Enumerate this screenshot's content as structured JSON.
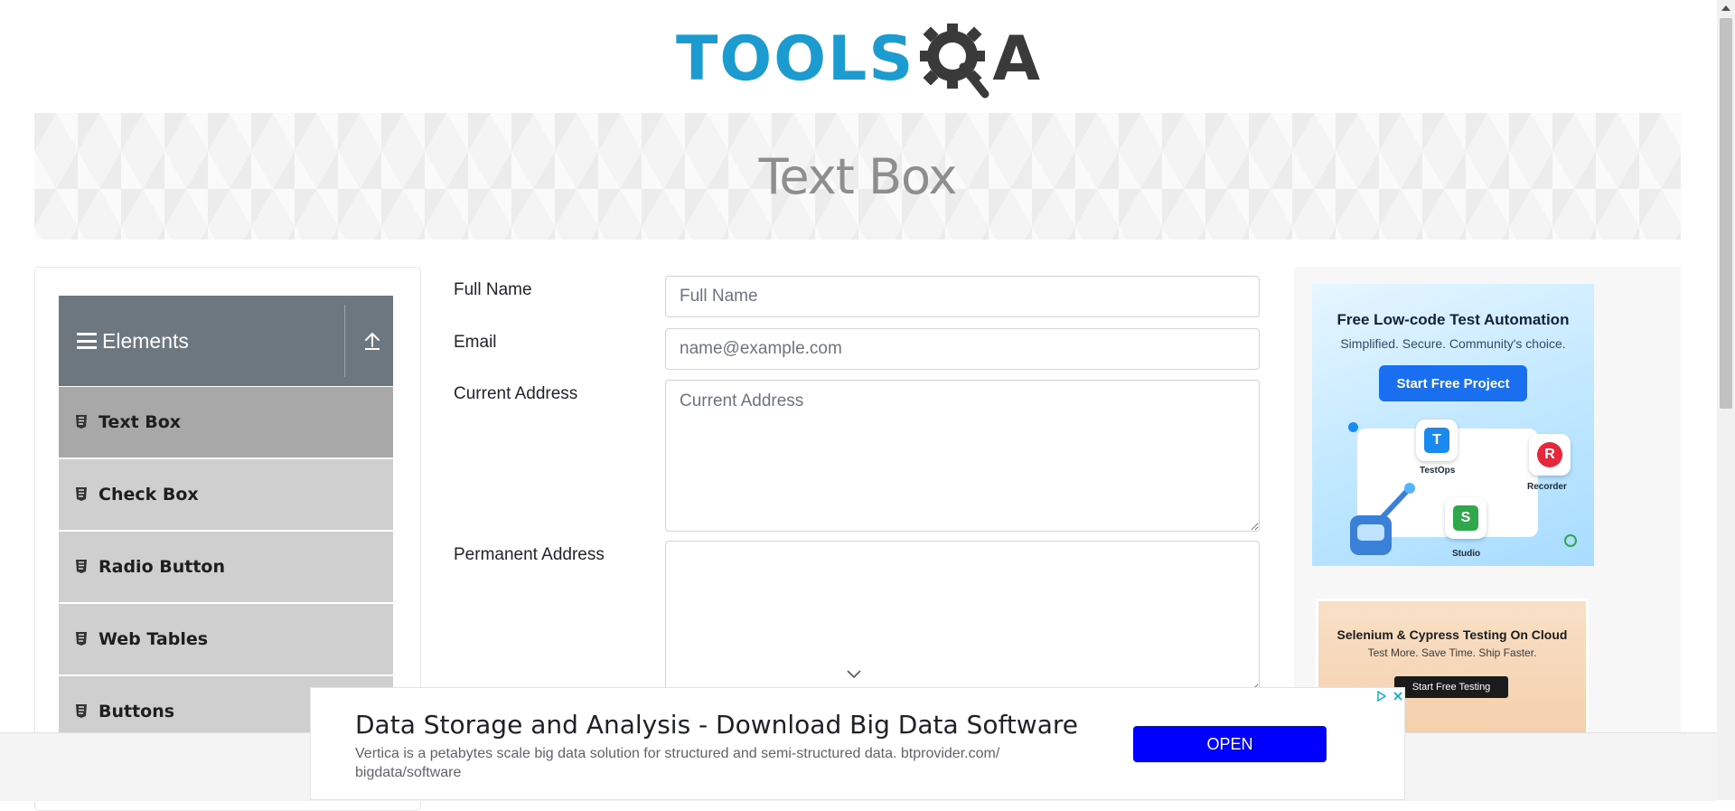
{
  "logo": {
    "text": "TOOLS",
    "suffix": "A",
    "colors": {
      "blue": "#1c9bd1",
      "dark": "#3a3a3a"
    }
  },
  "banner": {
    "title": "Text Box"
  },
  "sidebar": {
    "group_title": "Elements",
    "header_color": "#6c7780",
    "items": [
      {
        "label": "Text Box",
        "active": true
      },
      {
        "label": "Check Box"
      },
      {
        "label": "Radio Button"
      },
      {
        "label": "Web Tables"
      },
      {
        "label": "Buttons"
      }
    ]
  },
  "form": {
    "full_name": {
      "label": "Full Name",
      "placeholder": "Full Name",
      "value": ""
    },
    "email": {
      "label": "Email",
      "placeholder": "name@example.com",
      "value": ""
    },
    "current_address": {
      "label": "Current Address",
      "placeholder": "Current Address",
      "value": ""
    },
    "permanent_address": {
      "label": "Permanent Address",
      "placeholder": "",
      "value": ""
    }
  },
  "ads": {
    "katalon": {
      "title": "Free Low-code Test Automation",
      "subtitle": "Simplified. Secure. Community's choice.",
      "button": "Start Free Project",
      "tiles": {
        "testops": "TestOps",
        "recorder": "Recorder",
        "studio": "Studio"
      },
      "accent": "#1a6ff0"
    },
    "cloud": {
      "title": "Selenium & Cypress Testing On Cloud",
      "subtitle": "Test More. Save Time. Ship Faster.",
      "button": "Start Free Testing"
    },
    "bottom": {
      "title": "Data Storage and Analysis - Download Big Data Software",
      "description": "Vertica is a petabytes scale big data solution for structured and semi-structured data. btprovider.com/ bigdata/software",
      "button": "OPEN",
      "button_color": "#0000ff"
    }
  }
}
